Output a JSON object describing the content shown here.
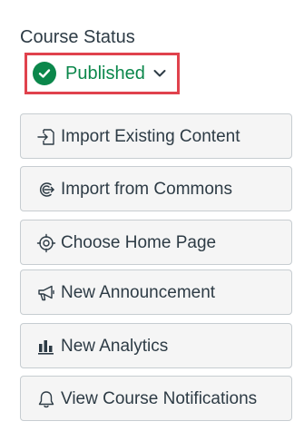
{
  "course_status": {
    "heading": "Course Status",
    "status_label": "Published"
  },
  "actions": [
    {
      "label": "Import Existing Content",
      "icon": "import-icon"
    },
    {
      "label": "Import from Commons",
      "icon": "commons-icon"
    },
    {
      "label": "Choose Home Page",
      "icon": "target-icon"
    },
    {
      "label": "New Announcement",
      "icon": "megaphone-icon"
    },
    {
      "label": "New Analytics",
      "icon": "analytics-icon"
    },
    {
      "label": "View Course Notifications",
      "icon": "bell-icon"
    }
  ],
  "colors": {
    "published_green": "#0b874b",
    "highlight_red": "#e0424d",
    "button_bg": "#f5f5f5",
    "button_border": "#c7cdd1",
    "text": "#2d3b45"
  }
}
